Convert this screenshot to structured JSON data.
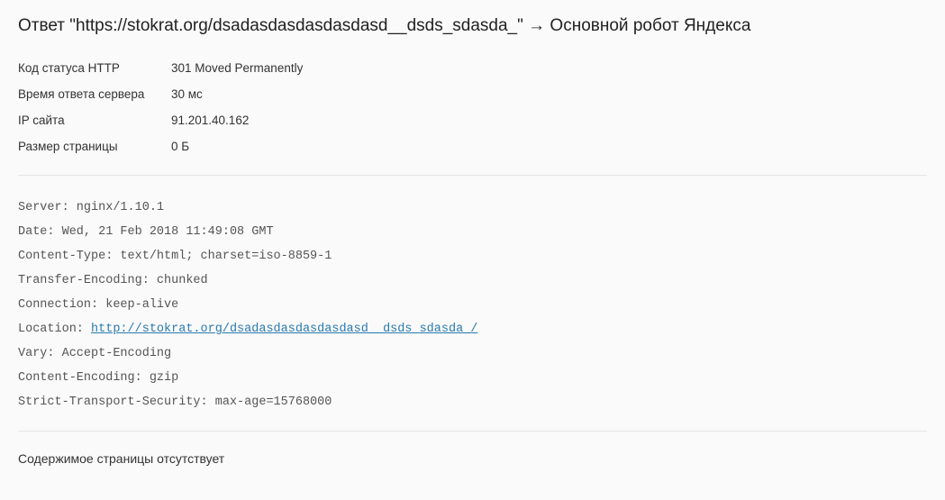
{
  "title": "Ответ \"https://stokrat.org/dsadasdasdasdasdasd__dsds_sdasda_\" → Основной робот Яндекса",
  "info": {
    "status_label": "Код статуса HTTP",
    "status_value": "301 Moved Permanently",
    "response_time_label": "Время ответа сервера",
    "response_time_value": "30 мс",
    "ip_label": "IP сайта",
    "ip_value": "91.201.40.162",
    "page_size_label": "Размер страницы",
    "page_size_value": "0 Б"
  },
  "headers": {
    "server": "Server: nginx/1.10.1",
    "date": "Date: Wed, 21 Feb 2018 11:49:08 GMT",
    "content_type": "Content-Type: text/html; charset=iso-8859-1",
    "transfer_encoding": "Transfer-Encoding: chunked",
    "connection": "Connection: keep-alive",
    "location_prefix": "Location: ",
    "location_url": "http://stokrat.org/dsadasdasdasdasdasd__dsds_sdasda_/",
    "vary": "Vary: Accept-Encoding",
    "content_encoding": "Content-Encoding: gzip",
    "strict_transport": "Strict-Transport-Security: max-age=15768000"
  },
  "footer": "Содержимое страницы отсутствует"
}
